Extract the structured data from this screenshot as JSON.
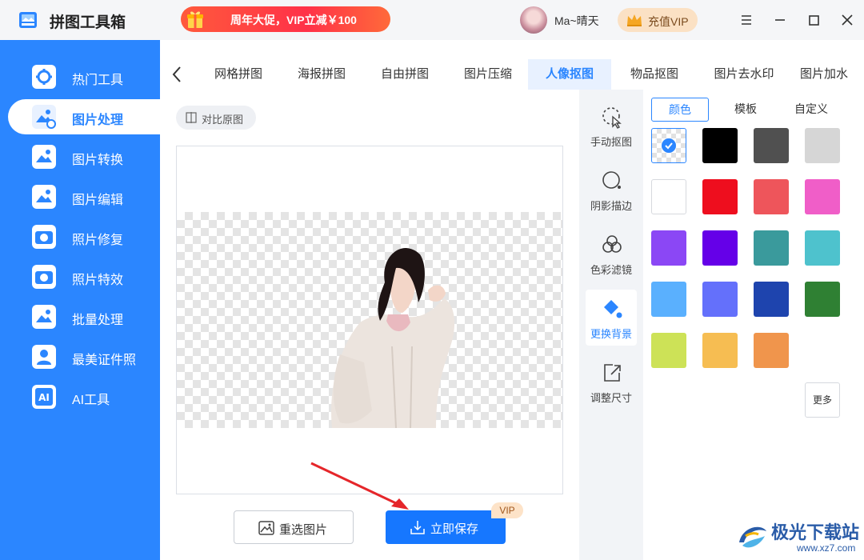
{
  "app": {
    "title": "拼图工具箱",
    "promo_text": "周年大促，VIP立减￥100",
    "username": "Ma~晴天",
    "vip_button": "充值VIP"
  },
  "sidebar": {
    "items": [
      {
        "label": "热门工具",
        "icon": "tools-gear-icon"
      },
      {
        "label": "图片处理",
        "icon": "image-process-icon",
        "active": true
      },
      {
        "label": "图片转换",
        "icon": "image-convert-icon"
      },
      {
        "label": "图片编辑",
        "icon": "image-edit-icon"
      },
      {
        "label": "照片修复",
        "icon": "camera-repair-icon"
      },
      {
        "label": "照片特效",
        "icon": "camera-effect-icon"
      },
      {
        "label": "批量处理",
        "icon": "batch-process-icon"
      },
      {
        "label": "最美证件照",
        "icon": "id-photo-icon"
      },
      {
        "label": "AI工具",
        "icon": "ai-icon"
      }
    ]
  },
  "tabs": [
    {
      "label": "网格拼图"
    },
    {
      "label": "海报拼图"
    },
    {
      "label": "自由拼图"
    },
    {
      "label": "图片压缩"
    },
    {
      "label": "人像抠图",
      "active": true
    },
    {
      "label": "物品抠图"
    },
    {
      "label": "图片去水印"
    },
    {
      "label": "图片加水"
    }
  ],
  "editor": {
    "compare_label": "对比原图",
    "reselect_label": "重选图片",
    "save_label": "立即保存",
    "vip_tag": "VIP"
  },
  "tools": [
    {
      "label": "手动抠图",
      "icon": "manual-cutout-icon"
    },
    {
      "label": "阴影描边",
      "icon": "shadow-outline-icon"
    },
    {
      "label": "色彩滤镜",
      "icon": "color-filter-icon"
    },
    {
      "label": "更换背景",
      "icon": "paint-bucket-icon",
      "active": true
    },
    {
      "label": "调整尺寸",
      "icon": "resize-icon"
    }
  ],
  "panel": {
    "tabs": [
      {
        "label": "颜色",
        "active": true
      },
      {
        "label": "模板"
      },
      {
        "label": "自定义"
      }
    ],
    "swatches": [
      "transparent",
      "#000000",
      "#505050",
      "#d6d6d6",
      "#ffffff",
      "#ee0e1e",
      "#ee555b",
      "#f05ec8",
      "#8b47f5",
      "#6500e8",
      "#3a9a9c",
      "#4ec2cd",
      "#5ab0fe",
      "#6470fb",
      "#1e44ae",
      "#2f8033",
      "#cde257",
      "#f6bd52",
      "#f0954c"
    ],
    "more_label": "更多"
  },
  "watermark": {
    "text": "极光下载站",
    "url": "www.xz7.com"
  }
}
